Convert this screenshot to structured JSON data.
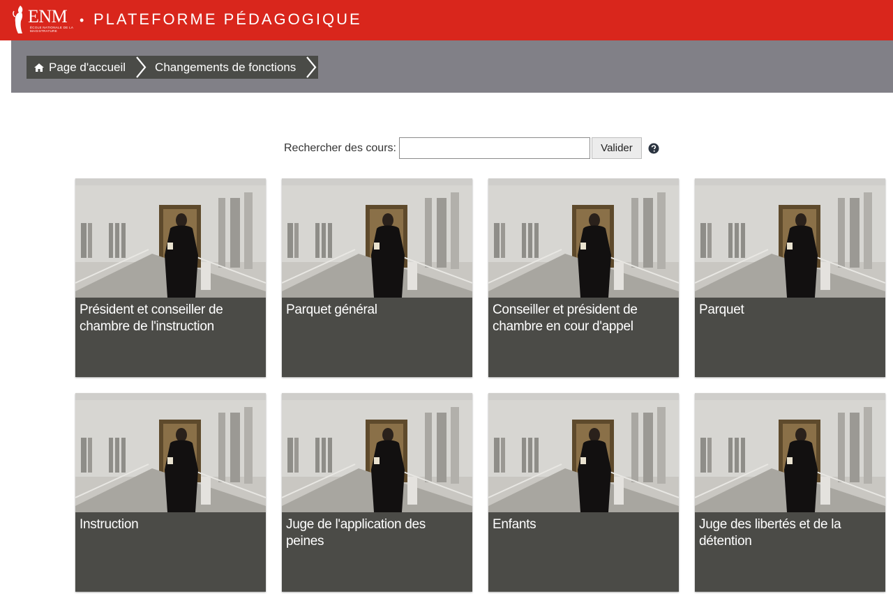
{
  "header": {
    "logo_text": "ENM",
    "logo_subtext": "ÉCOLE NATIONALE DE LA MAGISTRATURE",
    "separator": "•",
    "title": "PLATEFORME PÉDAGOGIQUE"
  },
  "breadcrumb": {
    "items": [
      {
        "label": "Page d'accueil",
        "icon": "home-icon"
      },
      {
        "label": "Changements de fonctions"
      }
    ]
  },
  "search": {
    "label": "Rechercher des cours:",
    "value": "",
    "placeholder": "",
    "button_label": "Valider",
    "help_icon": "question-circle-icon"
  },
  "courses": [
    {
      "title": "Président et conseiller de chambre de l'instruction"
    },
    {
      "title": "Parquet général"
    },
    {
      "title": "Conseiller et président de chambre en cour d'appel"
    },
    {
      "title": "Parquet"
    },
    {
      "title": "Instruction"
    },
    {
      "title": "Juge de l'application des peines"
    },
    {
      "title": "Enfants"
    },
    {
      "title": "Juge des libertés et de la détention"
    }
  ],
  "colors": {
    "header_red": "#d9261c",
    "band_gray": "#818087",
    "breadcrumb_bg": "#4a4b47",
    "card_bg": "#4b4b47"
  }
}
